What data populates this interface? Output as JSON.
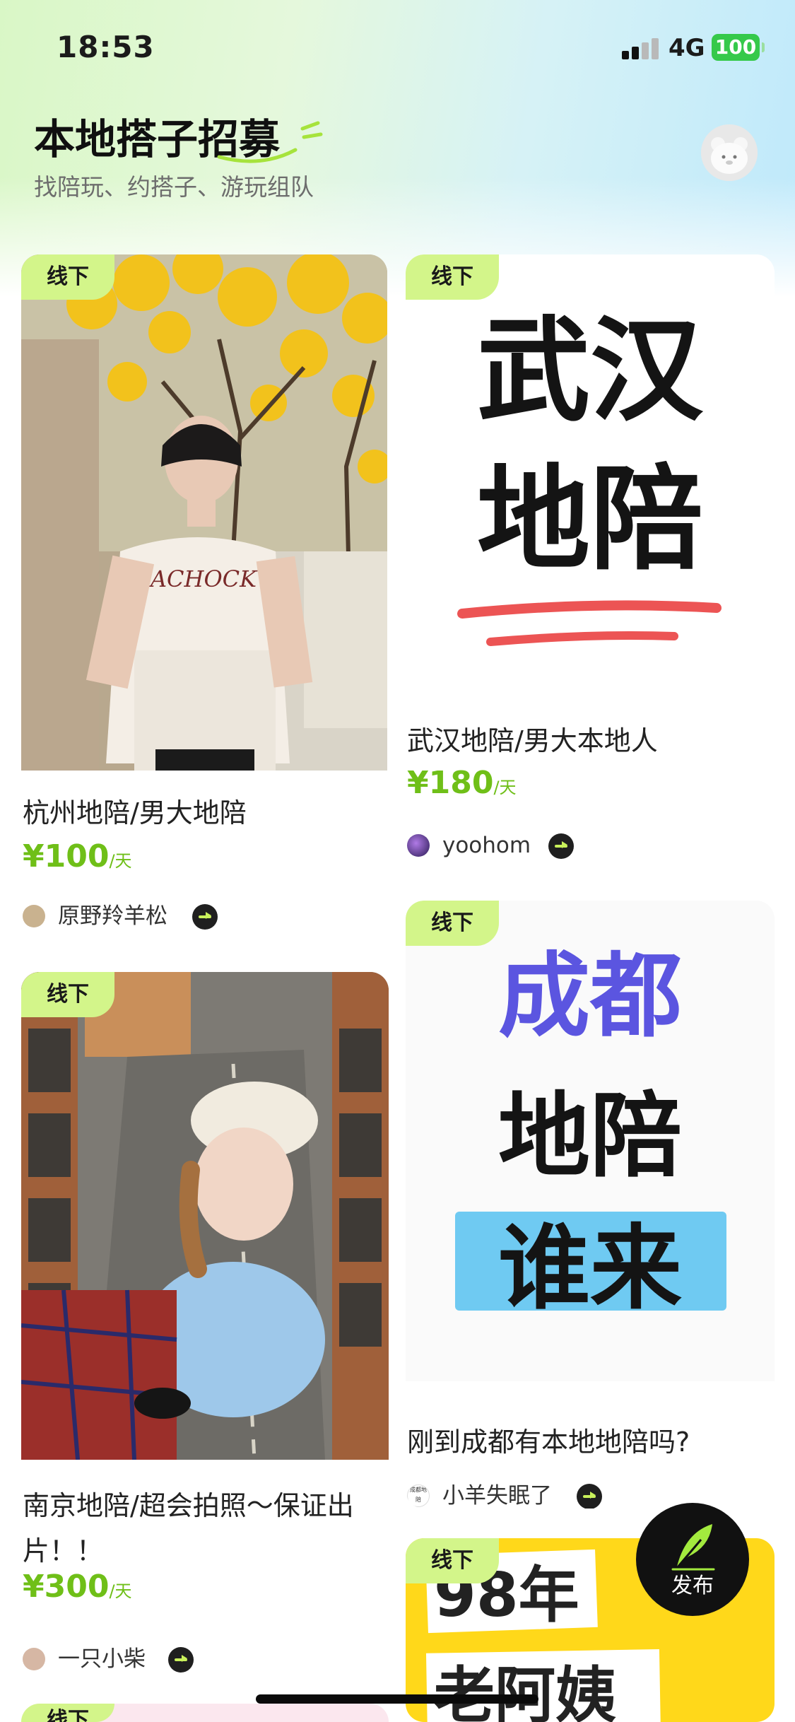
{
  "status_bar": {
    "time": "18:53",
    "network": "4G",
    "battery": "100"
  },
  "header": {
    "title": "本地搭子招募",
    "subtitle": "找陪玩、约搭子、游玩组队"
  },
  "cards": [
    {
      "tag": "线下",
      "title": "杭州地陪/男大地陪",
      "price": "¥100",
      "unit": "/天",
      "author": "原野羚羊松",
      "image_text": "ACHOCK"
    },
    {
      "tag": "线下",
      "title": "武汉地陪/男大本地人",
      "price": "¥180",
      "unit": "/天",
      "author": "yoohom",
      "image_lines": [
        "武汉",
        "地陪"
      ]
    },
    {
      "tag": "线下",
      "title": "南京地陪/超会拍照～保证出片！！",
      "price": "¥300",
      "unit": "/天",
      "author": "一只小柴"
    },
    {
      "tag": "线下",
      "title": "刚到成都有本地地陪吗?",
      "author": "小羊失眠了",
      "image_lines": [
        "成都",
        "地陪",
        "谁来"
      ],
      "avatar_text": "成都地陪"
    },
    {
      "tag": "线下",
      "image_lines": [
        "98年",
        "老阿姨"
      ]
    },
    {
      "tag": "线下"
    }
  ],
  "fab": {
    "label": "发布"
  },
  "colors": {
    "accent_green": "#6fbf18",
    "tag_green": "#d3f58a",
    "battery": "#35c94a"
  }
}
